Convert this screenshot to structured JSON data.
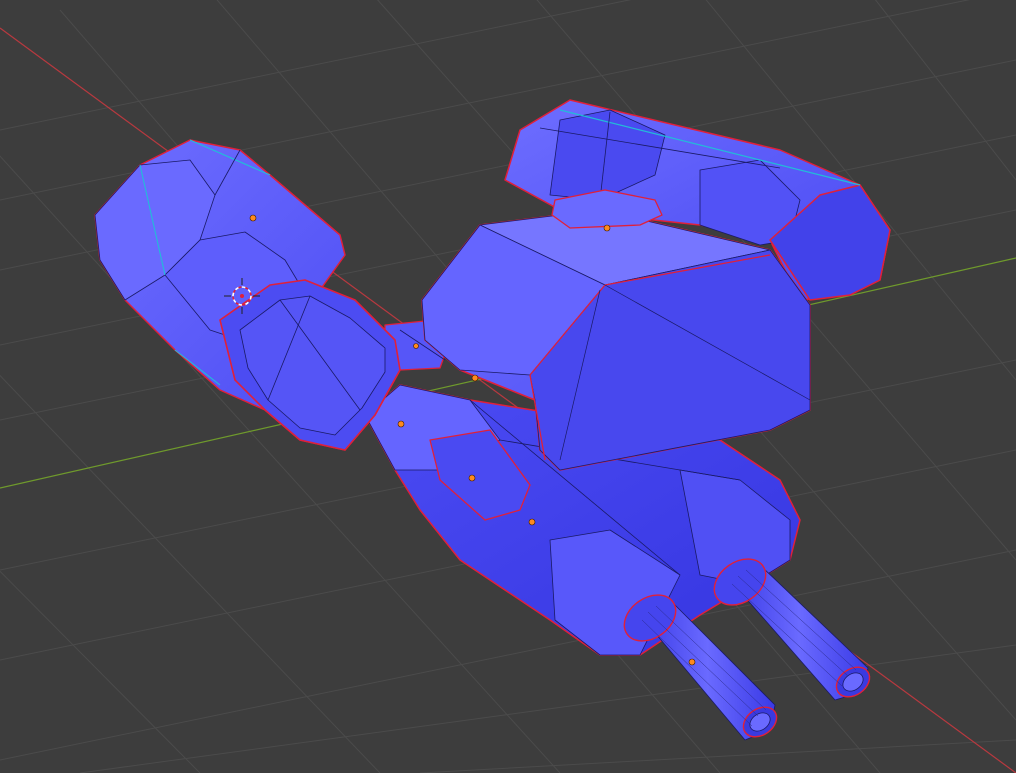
{
  "viewport": {
    "mode": "3d-viewport-wireframe-overlay",
    "background_color": "#3d3d3d",
    "grid_color": "#4a4a4a",
    "x_axis_color": "#c0393f",
    "y_axis_color": "#6f9a2c",
    "mesh_face_color": "#5b5bff",
    "mesh_face_dark_color": "#3c3cf0",
    "mesh_face_light_color": "#7272ff",
    "wire_color": "#1a1a66",
    "selected_edge_color": "#e0203a",
    "seam_edge_color": "#22bcd8",
    "origin_dot_color": "#ff8a1e"
  },
  "scene": {
    "object": "mech-turret-mesh",
    "components": [
      "left-shoulder-pod",
      "right-shoulder-pod",
      "central-turret-body",
      "lower-chassis",
      "left-barrel",
      "right-barrel",
      "connector-arm"
    ],
    "cursor": "3d-cursor-icon"
  }
}
